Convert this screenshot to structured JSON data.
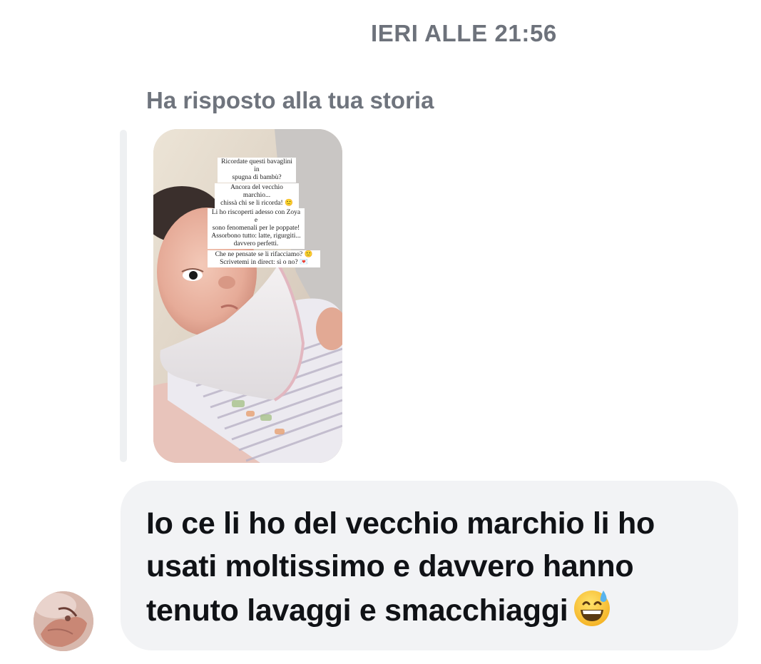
{
  "conversation": {
    "timestamp": "IERI ALLE 21:56",
    "reply_label": "Ha risposto alla tua storia",
    "story": {
      "caption_1": "Ricordate questi bavaglini in\nspugna di bambù?",
      "caption_2": "Ancora del vecchio marchio...\nchissà chi se li ricorda! 🙂",
      "caption_3": "Li ho riscoperti adesso con Zoya e\nsono fenomenali per le poppate!\nAssorbono tutto: latte, rigurgiti...\ndavvero perfetti.",
      "caption_4": "Che ne pensate se li rifacciamo? 🙂\nScrivetemi in direct: sì o no? 💌"
    },
    "message": {
      "text": "Io ce li ho del vecchio marchio li ho usati moltissimo e davvero hanno tenuto lavaggi e smacchiaggi",
      "emoji": "grinning-face-with-sweat-icon"
    }
  },
  "colors": {
    "bubble_bg": "#f2f3f5",
    "meta_text": "#6d727b",
    "message_text": "#101216"
  }
}
